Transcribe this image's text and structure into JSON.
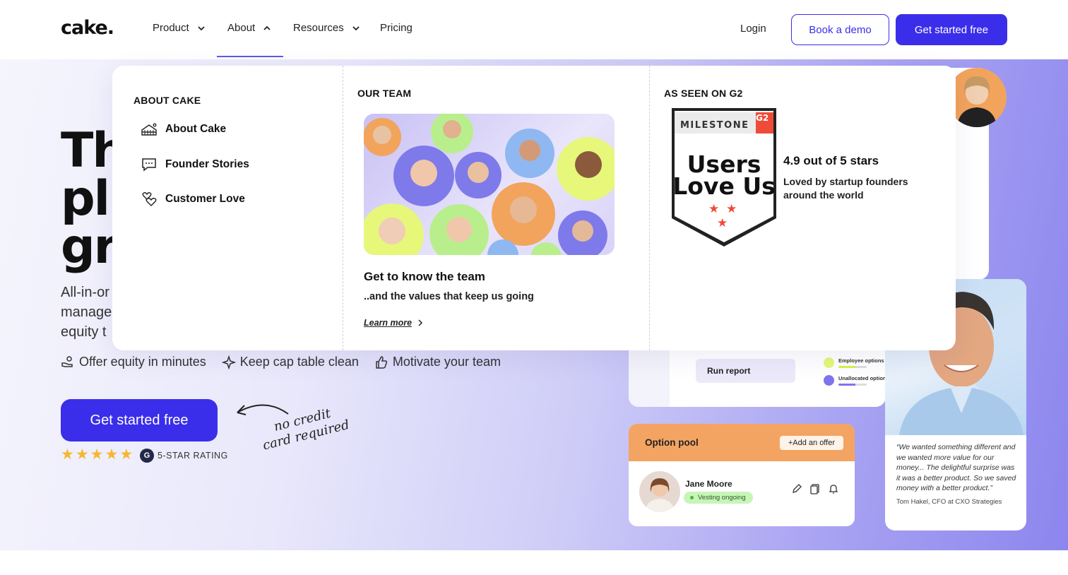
{
  "nav": {
    "logo": "cake.",
    "items": [
      {
        "label": "Product"
      },
      {
        "label": "About"
      },
      {
        "label": "Resources"
      },
      {
        "label": "Pricing"
      }
    ],
    "login": "Login",
    "book_demo": "Book a demo",
    "get_started": "Get started free"
  },
  "hero": {
    "title_lines": [
      "Th",
      "pl",
      "gr"
    ],
    "subtitle_lines": [
      "All-in-or",
      "manage",
      "equity t"
    ],
    "features": [
      "Offer equity in minutes",
      "Keep cap table clean",
      "Motivate your team"
    ],
    "cta": "Get started free",
    "rating": {
      "stars": 5,
      "label": "5-STAR RATING"
    },
    "note": [
      "no credit",
      "card required"
    ]
  },
  "mega_menu": {
    "about": {
      "heading": "ABOUT CAKE",
      "links": [
        "About Cake",
        "Founder Stories",
        "Customer Love"
      ]
    },
    "team": {
      "heading": "OUR TEAM",
      "title": "Get to know the team",
      "subtitle": "..and the values that keep us going",
      "link": "Learn more"
    },
    "g2": {
      "heading": "AS SEEN ON G2",
      "badge_top": "MILESTONE",
      "badge_line1": "Users",
      "badge_line2": "Love Us",
      "rating": "4.9 out of 5 stars",
      "description": "Loved by startup founders around the world"
    }
  },
  "side_cards": {
    "run_report": "Run report",
    "legend": [
      "Employee options",
      "Unallocated option"
    ],
    "option_pool": {
      "title": "Option pool",
      "button": "+Add an offer",
      "person": "Jane Moore",
      "status": "Vesting ongoing"
    },
    "testimonial": {
      "quote": "“We wanted something different and we wanted more value for our money... The delightful surprise was it was a better product. So we saved money with a better product.”",
      "author": "Tom Hakel, CFO at CXO Strategies"
    }
  },
  "colors": {
    "primary": "#3b2eea",
    "orange": "#f4a462",
    "star": "#f5b731",
    "green_badge": "#c7f5b8"
  }
}
